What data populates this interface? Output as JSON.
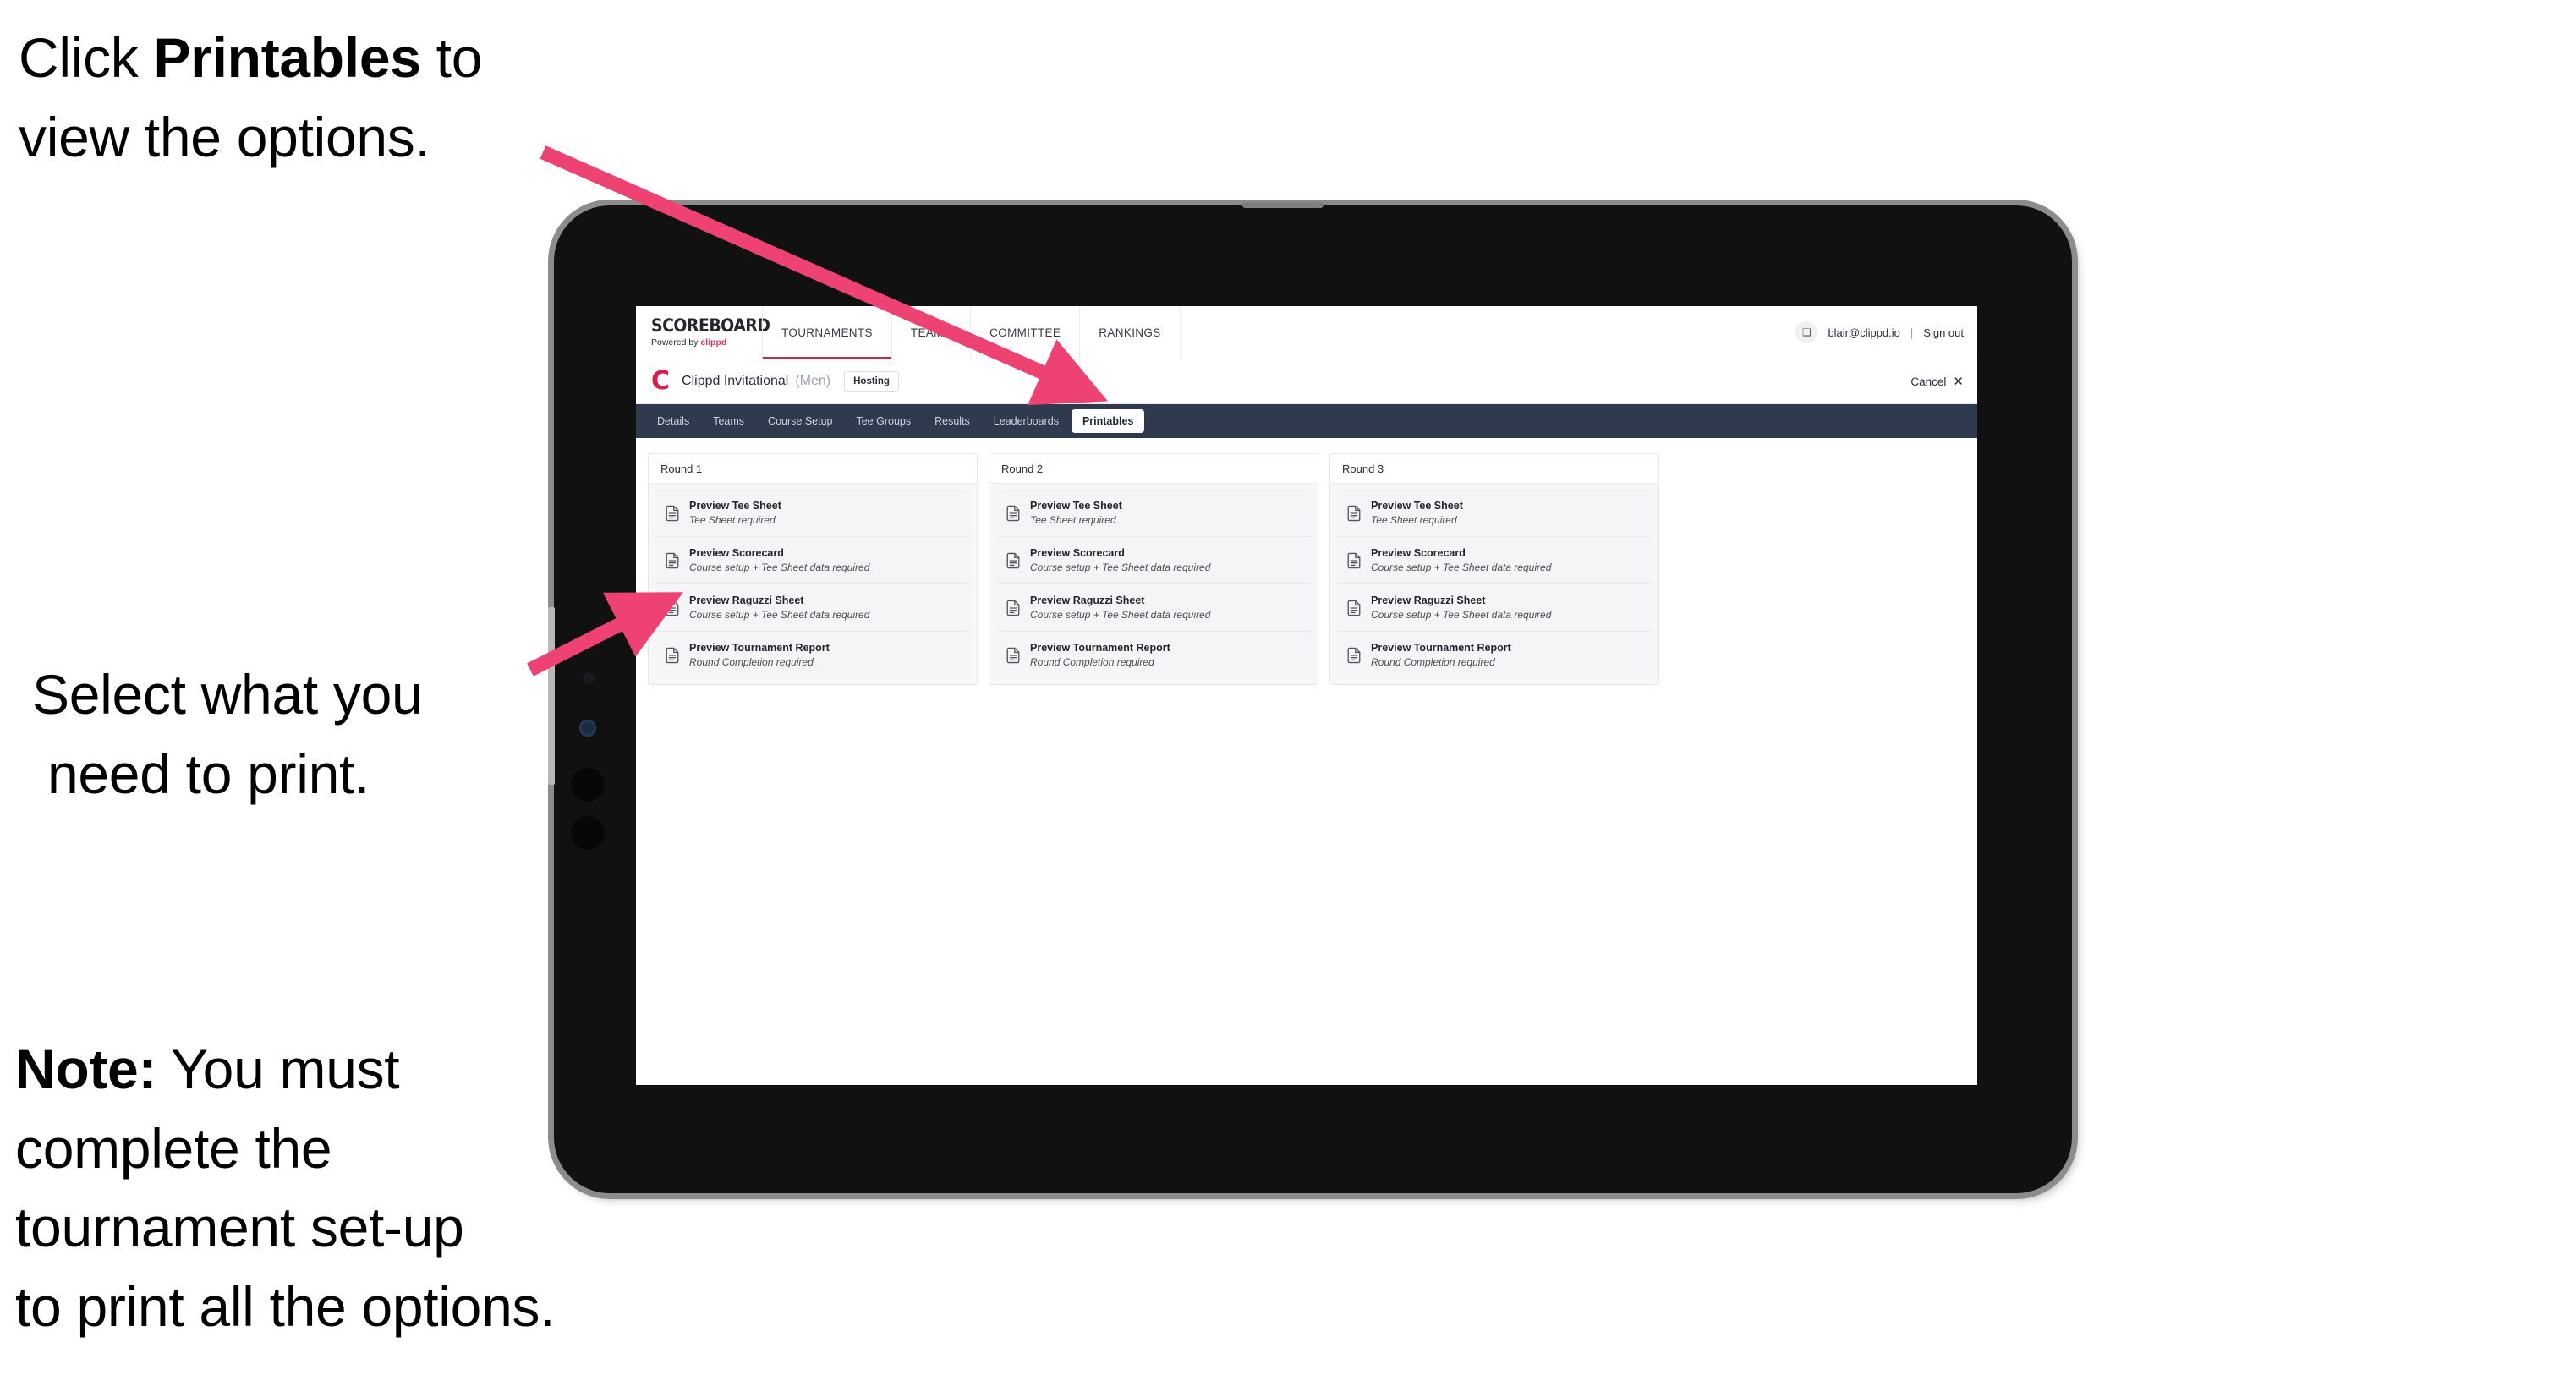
{
  "annotations": {
    "step1_prefix": "Click ",
    "step1_bold": "Printables",
    "step1_suffix": " to",
    "step1_line2": "view the options.",
    "step2_line1": "Select what you",
    "step2_line2": "need to print.",
    "note_bold": "Note:",
    "note_rest": " You must",
    "note_line2": "complete the",
    "note_line3": "tournament set-up",
    "note_line4": "to print all the options.",
    "arrow_color": "#ee4272"
  },
  "app": {
    "brand": {
      "title": "SCOREBOARD",
      "powered_prefix": "Powered by ",
      "powered_accent": "clippd"
    },
    "nav_tabs": [
      {
        "label": "TOURNAMENTS",
        "active": true
      },
      {
        "label": "TEAMS",
        "active": false
      },
      {
        "label": "COMMITTEE",
        "active": false
      },
      {
        "label": "RANKINGS",
        "active": false
      }
    ],
    "account": {
      "avatar_glyph": "❑",
      "email": "blair@clippd.io",
      "separator": "|",
      "sign_out": "Sign out"
    },
    "tournament": {
      "logo_letter": "C",
      "name": "Clippd Invitational",
      "gender": "(Men)",
      "status_badge": "Hosting",
      "cancel_label": "Cancel",
      "cancel_glyph": "✕"
    },
    "section_tabs": [
      {
        "label": "Details",
        "active": false
      },
      {
        "label": "Teams",
        "active": false
      },
      {
        "label": "Course Setup",
        "active": false
      },
      {
        "label": "Tee Groups",
        "active": false
      },
      {
        "label": "Results",
        "active": false
      },
      {
        "label": "Leaderboards",
        "active": false
      },
      {
        "label": "Printables",
        "active": true
      }
    ],
    "printables": {
      "rounds": [
        {
          "title": "Round 1",
          "items": [
            {
              "title": "Preview Tee Sheet",
              "requirement": "Tee Sheet required",
              "icon": "document-icon"
            },
            {
              "title": "Preview Scorecard",
              "requirement": "Course setup + Tee Sheet data required",
              "icon": "document-icon"
            },
            {
              "title": "Preview Raguzzi Sheet",
              "requirement": "Course setup + Tee Sheet data required",
              "icon": "document-icon"
            },
            {
              "title": "Preview Tournament Report",
              "requirement": "Round Completion required",
              "icon": "document-icon"
            }
          ]
        },
        {
          "title": "Round 2",
          "items": [
            {
              "title": "Preview Tee Sheet",
              "requirement": "Tee Sheet required",
              "icon": "document-icon"
            },
            {
              "title": "Preview Scorecard",
              "requirement": "Course setup + Tee Sheet data required",
              "icon": "document-icon"
            },
            {
              "title": "Preview Raguzzi Sheet",
              "requirement": "Course setup + Tee Sheet data required",
              "icon": "document-icon"
            },
            {
              "title": "Preview Tournament Report",
              "requirement": "Round Completion required",
              "icon": "document-icon"
            }
          ]
        },
        {
          "title": "Round 3",
          "items": [
            {
              "title": "Preview Tee Sheet",
              "requirement": "Tee Sheet required",
              "icon": "document-icon"
            },
            {
              "title": "Preview Scorecard",
              "requirement": "Course setup + Tee Sheet data required",
              "icon": "document-icon"
            },
            {
              "title": "Preview Raguzzi Sheet",
              "requirement": "Course setup + Tee Sheet data required",
              "icon": "document-icon"
            },
            {
              "title": "Preview Tournament Report",
              "requirement": "Round Completion required",
              "icon": "document-icon"
            }
          ]
        }
      ]
    },
    "theme": {
      "section_bar": "#2f3a4f",
      "brand_accent": "#e8345a",
      "tab_underline": "#b0334e"
    }
  }
}
